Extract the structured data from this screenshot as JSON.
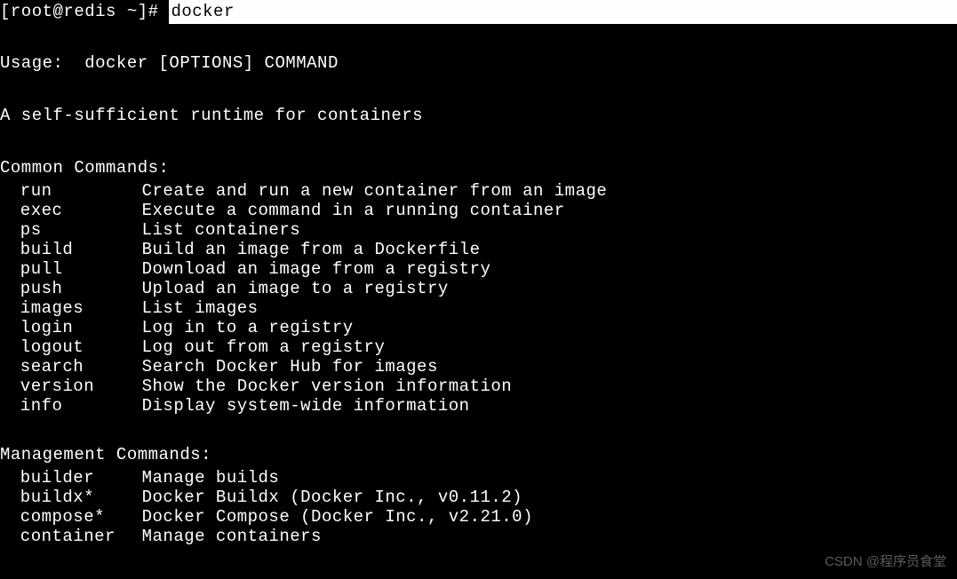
{
  "prompt": "[root@redis ~]# ",
  "command": "docker",
  "usage": "Usage:  docker [OPTIONS] COMMAND",
  "description": "A self-sufficient runtime for containers",
  "common_header": "Common Commands:",
  "common_commands": [
    {
      "name": "run",
      "desc": "Create and run a new container from an image"
    },
    {
      "name": "exec",
      "desc": "Execute a command in a running container"
    },
    {
      "name": "ps",
      "desc": "List containers"
    },
    {
      "name": "build",
      "desc": "Build an image from a Dockerfile"
    },
    {
      "name": "pull",
      "desc": "Download an image from a registry"
    },
    {
      "name": "push",
      "desc": "Upload an image to a registry"
    },
    {
      "name": "images",
      "desc": "List images"
    },
    {
      "name": "login",
      "desc": "Log in to a registry"
    },
    {
      "name": "logout",
      "desc": "Log out from a registry"
    },
    {
      "name": "search",
      "desc": "Search Docker Hub for images"
    },
    {
      "name": "version",
      "desc": "Show the Docker version information"
    },
    {
      "name": "info",
      "desc": "Display system-wide information"
    }
  ],
  "mgmt_header": "Management Commands:",
  "mgmt_commands": [
    {
      "name": "builder",
      "desc": "Manage builds"
    },
    {
      "name": "buildx*",
      "desc": "Docker Buildx (Docker Inc., v0.11.2)"
    },
    {
      "name": "compose*",
      "desc": "Docker Compose (Docker Inc., v2.21.0)"
    },
    {
      "name": "container",
      "desc": "Manage containers"
    }
  ],
  "watermark": "CSDN @程序员食堂"
}
